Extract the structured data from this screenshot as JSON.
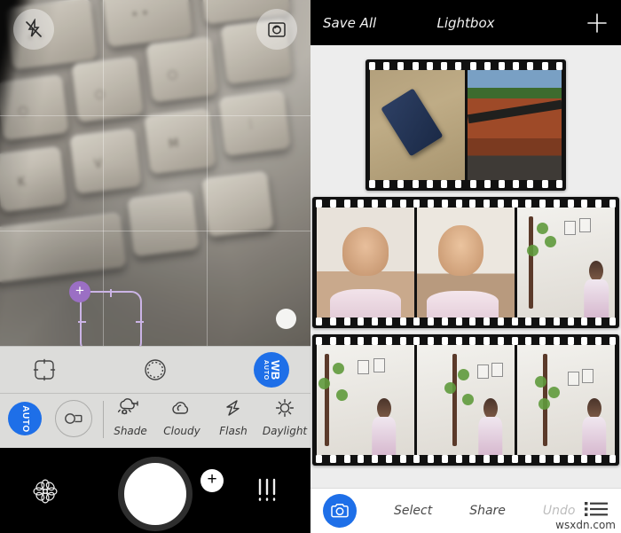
{
  "camera": {
    "top_controls": [
      {
        "name": "flash-off-icon",
        "label": "Flash Off"
      },
      {
        "name": "switch-camera-icon",
        "label": "Switch Camera"
      }
    ],
    "focus": {
      "handle_label": "+",
      "reticle_color": "#cbb4e6",
      "handle_color": "#9b6fc4"
    },
    "row1": {
      "frame_icon_label": "Focus Frame",
      "exposure_icon_label": "Exposure Ring",
      "wb_badge": {
        "main": "WB",
        "sub": "AUTO",
        "color": "#1e6fe8"
      }
    },
    "row2": {
      "auto_badge": {
        "label": "AUTO",
        "color": "#1e6fe8"
      },
      "lens_label": "Lens",
      "wb_options": [
        {
          "label": "Shade",
          "icon": "shade-icon"
        },
        {
          "label": "Cloudy",
          "icon": "cloudy-icon"
        },
        {
          "label": "Flash",
          "icon": "flash-icon"
        },
        {
          "label": "Daylight",
          "icon": "daylight-icon"
        }
      ]
    },
    "shutter_bar": {
      "effects_label": "Effects",
      "shutter_label": "Shutter",
      "add_label": "+",
      "settings_label": "Settings"
    }
  },
  "lightbox": {
    "topbar": {
      "save_all": "Save All",
      "title": "Lightbox",
      "add_label": "+"
    },
    "filmstrips": [
      {
        "name": "filmstrip-row-1",
        "frames": [
          {
            "caption": "SD card on wooden table",
            "style": "ph-sdcard"
          },
          {
            "caption": "Tiled rooftops",
            "style": "ph-roof"
          }
        ]
      },
      {
        "name": "filmstrip-row-2",
        "frames": [
          {
            "caption": "Girl making face",
            "style": "ph-portrait-a"
          },
          {
            "caption": "Girl peace sign",
            "style": "ph-portrait-b"
          },
          {
            "caption": "Girl by tree wall",
            "style": "ph-wall"
          }
        ]
      },
      {
        "name": "filmstrip-row-3",
        "frames": [
          {
            "caption": "Girl by tree wall close",
            "style": "ph-wall"
          },
          {
            "caption": "Girl standing at wall",
            "style": "ph-wall"
          },
          {
            "caption": "Girl reaching at wall",
            "style": "ph-wall"
          }
        ]
      }
    ],
    "bottom": {
      "camera_label": "Camera",
      "select": "Select",
      "share": "Share",
      "undo": "Undo",
      "menu_label": "Menu"
    }
  },
  "watermark": "wsxdn.com"
}
